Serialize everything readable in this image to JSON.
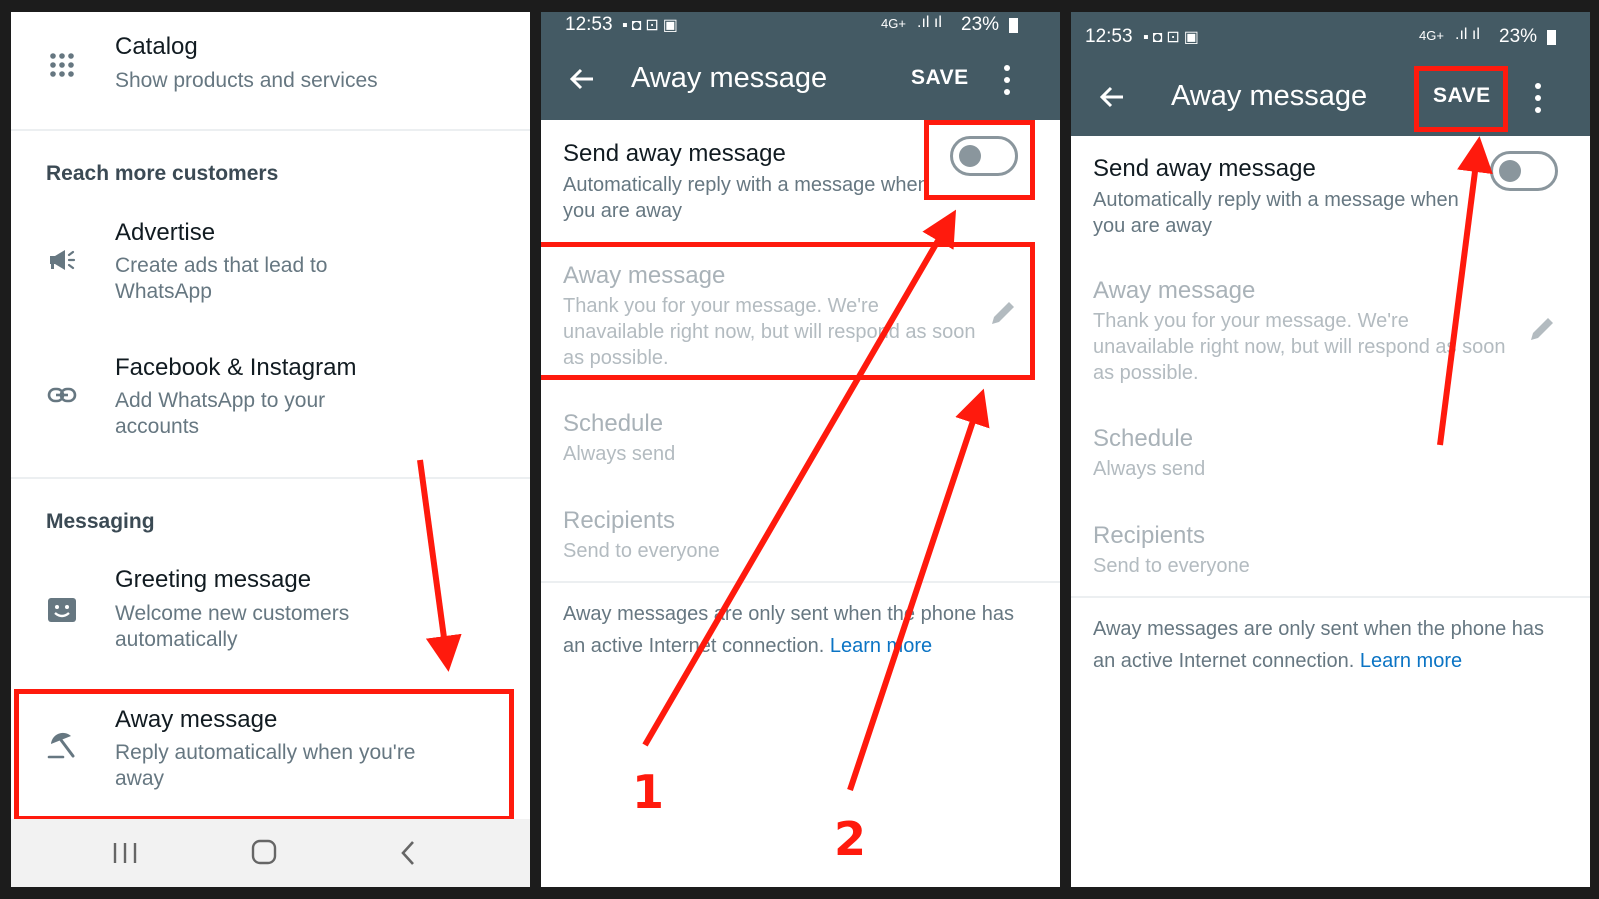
{
  "panel1": {
    "catalog": {
      "title": "Catalog",
      "subtitle": "Show products and services",
      "icon": "grid-icon"
    },
    "section_reach": "Reach more customers",
    "advertise": {
      "title": "Advertise",
      "subtitle": "Create ads that lead to WhatsApp",
      "icon": "megaphone-icon"
    },
    "fb_ig": {
      "title": "Facebook & Instagram",
      "subtitle": "Add WhatsApp to your accounts",
      "icon": "link-icon"
    },
    "section_messaging": "Messaging",
    "greeting": {
      "title": "Greeting message",
      "subtitle": "Welcome new customers automatically",
      "icon": "greeting-icon"
    },
    "away": {
      "title": "Away message",
      "subtitle": "Reply automatically when you're away",
      "icon": "beach-umbrella-icon"
    }
  },
  "status": {
    "time": "12:53",
    "battery": "23%",
    "network": "4G+"
  },
  "screen": {
    "title": "Away message",
    "save": "SAVE",
    "send_title": "Send away message",
    "send_sub": "Automatically reply with a message when you are away",
    "toggle_on": false,
    "msg_title": "Away message",
    "msg_body": "Thank you for your message. We're unavailable right now, but will respond as soon as possible.",
    "schedule_title": "Schedule",
    "schedule_value": "Always send",
    "recipients_title": "Recipients",
    "recipients_value": "Send to everyone",
    "note": "Away messages are only sent when the phone has an active Internet connection.",
    "learn_more": "Learn more"
  },
  "annotations": {
    "step1": "1",
    "step2": "2"
  },
  "colors": {
    "appbar": "#445a64",
    "highlight": "#ff1a0d",
    "link": "#0b74c4"
  }
}
